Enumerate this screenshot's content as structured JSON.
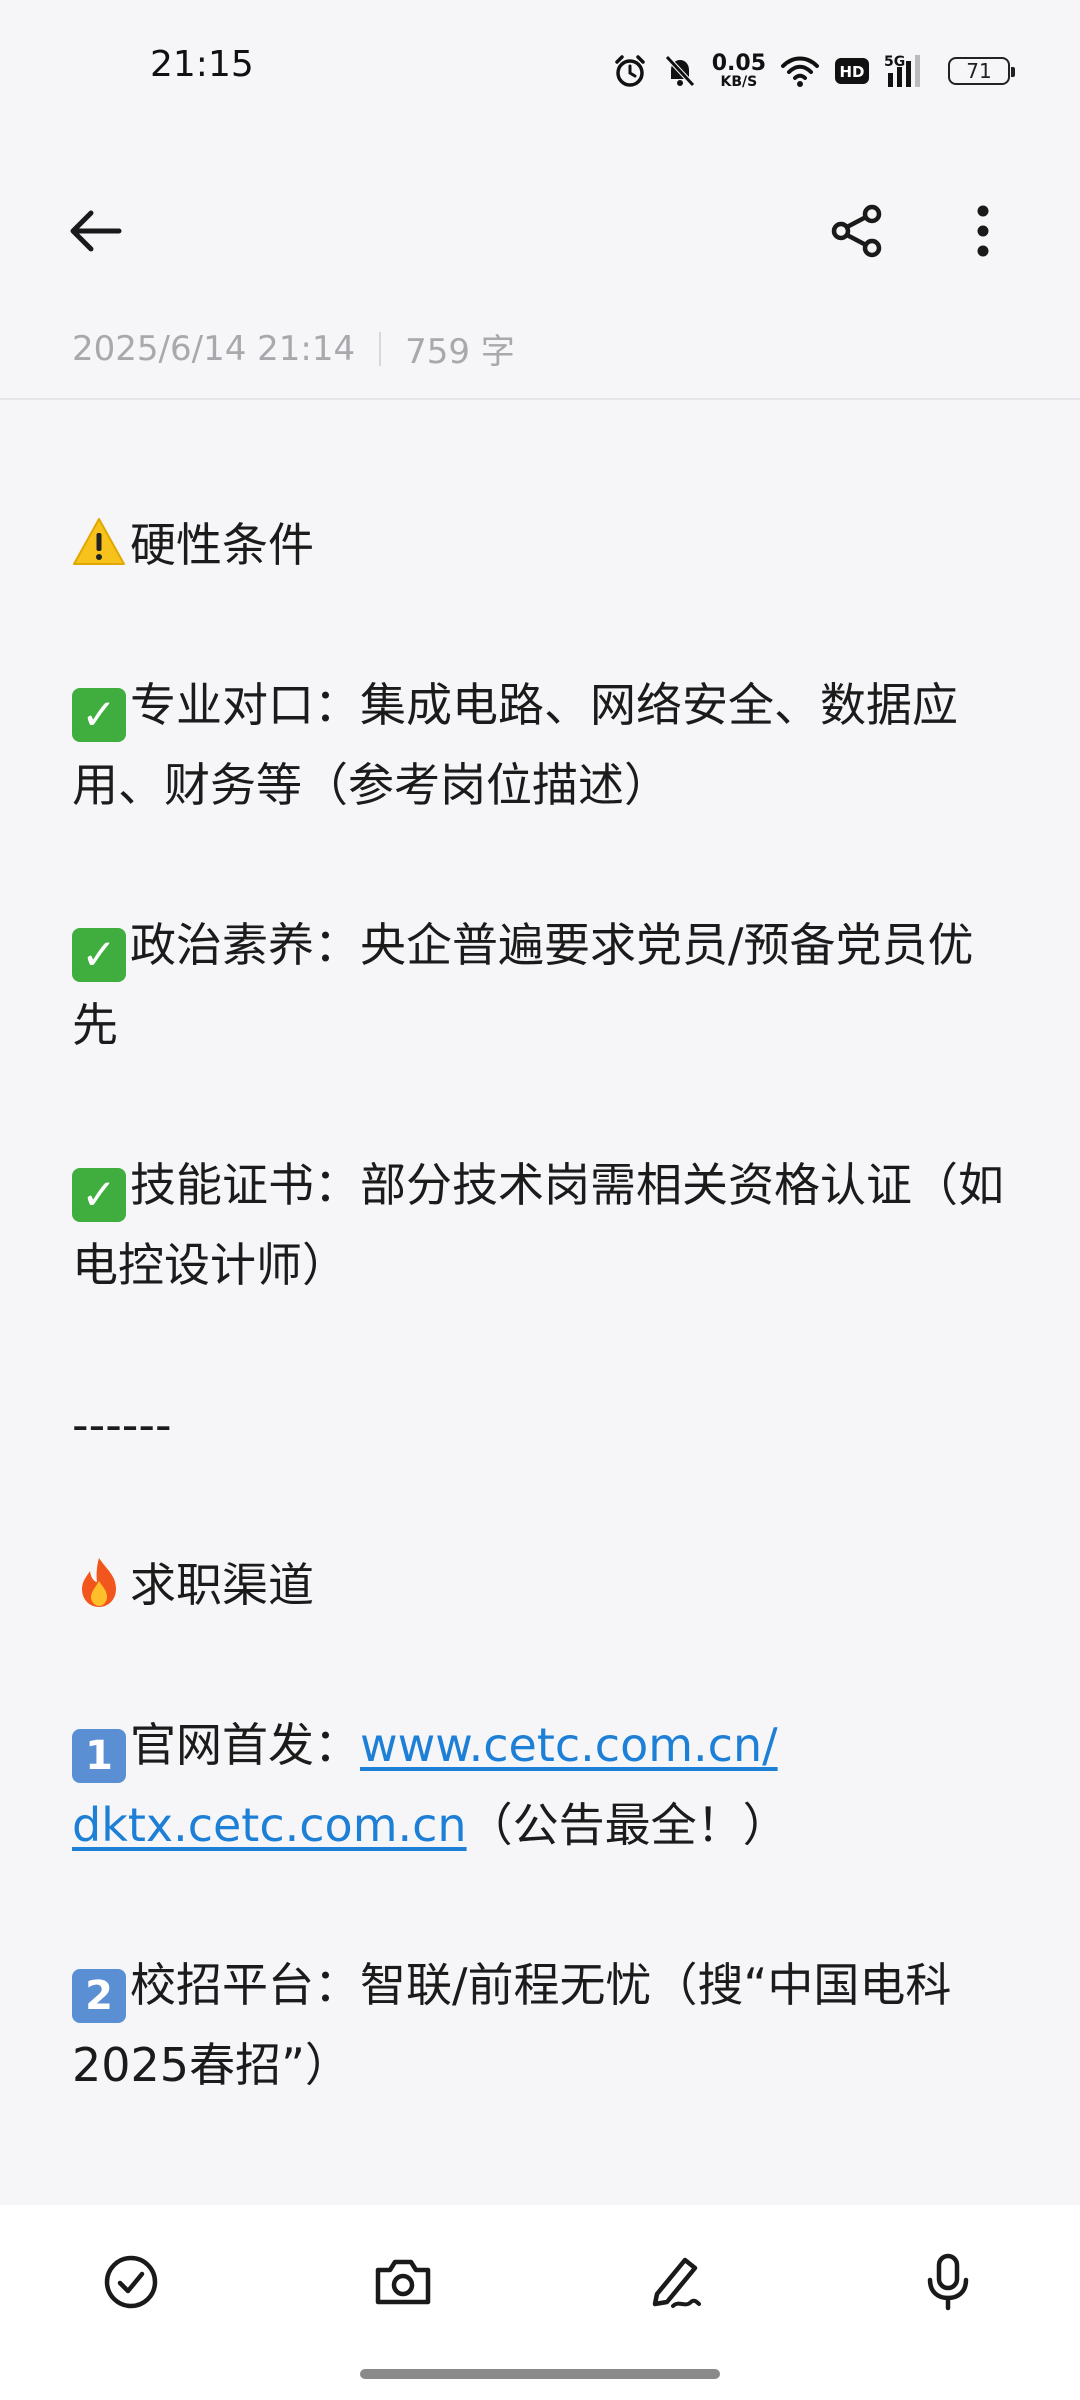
{
  "status_bar": {
    "time": "21:15",
    "net_speed_value": "0.05",
    "net_speed_unit": "KB/S",
    "hd_label": "HD",
    "network_label": "5G",
    "battery": "71",
    "icons": [
      "alarm-icon",
      "mute-icon",
      "wifi-icon",
      "hd-icon",
      "signal-icon",
      "battery-icon"
    ]
  },
  "nav": {
    "icons": [
      "back-arrow-icon",
      "share-icon",
      "more-vert-icon"
    ]
  },
  "meta": {
    "datetime": "2025/6/14 21:14",
    "word_count": "759 字"
  },
  "note": {
    "heading1": "硬性条件",
    "item1": "专业对口：集成电路、网络安全、数据应用、财务等（参考岗位描述）",
    "item2": "政治素养：央企普遍要求党员/预备党员优先",
    "item3": "技能证书：部分技术岗需相关资格认证（如电控设计师）",
    "divider": "------",
    "heading2": "求职渠道",
    "channel1_prefix": "官网首发：",
    "channel1_link1": "www.cetc.com.cn/",
    "channel1_link2": "dktx.cetc.com.cn",
    "channel1_suffix": "（公告最全！）",
    "channel2": "校招平台：智联/前程无忧（搜“中国电科2025春招”）",
    "keycap1": "1",
    "keycap2": "2"
  },
  "toolbar": {
    "icons": [
      "checklist-icon",
      "camera-icon",
      "handwriting-icon",
      "microphone-icon"
    ]
  },
  "colors": {
    "link": "#1e7fd6",
    "check_green": "#3fae3f",
    "keycap_blue": "#5b8fd3",
    "meta_grey": "#a8a8ad"
  }
}
